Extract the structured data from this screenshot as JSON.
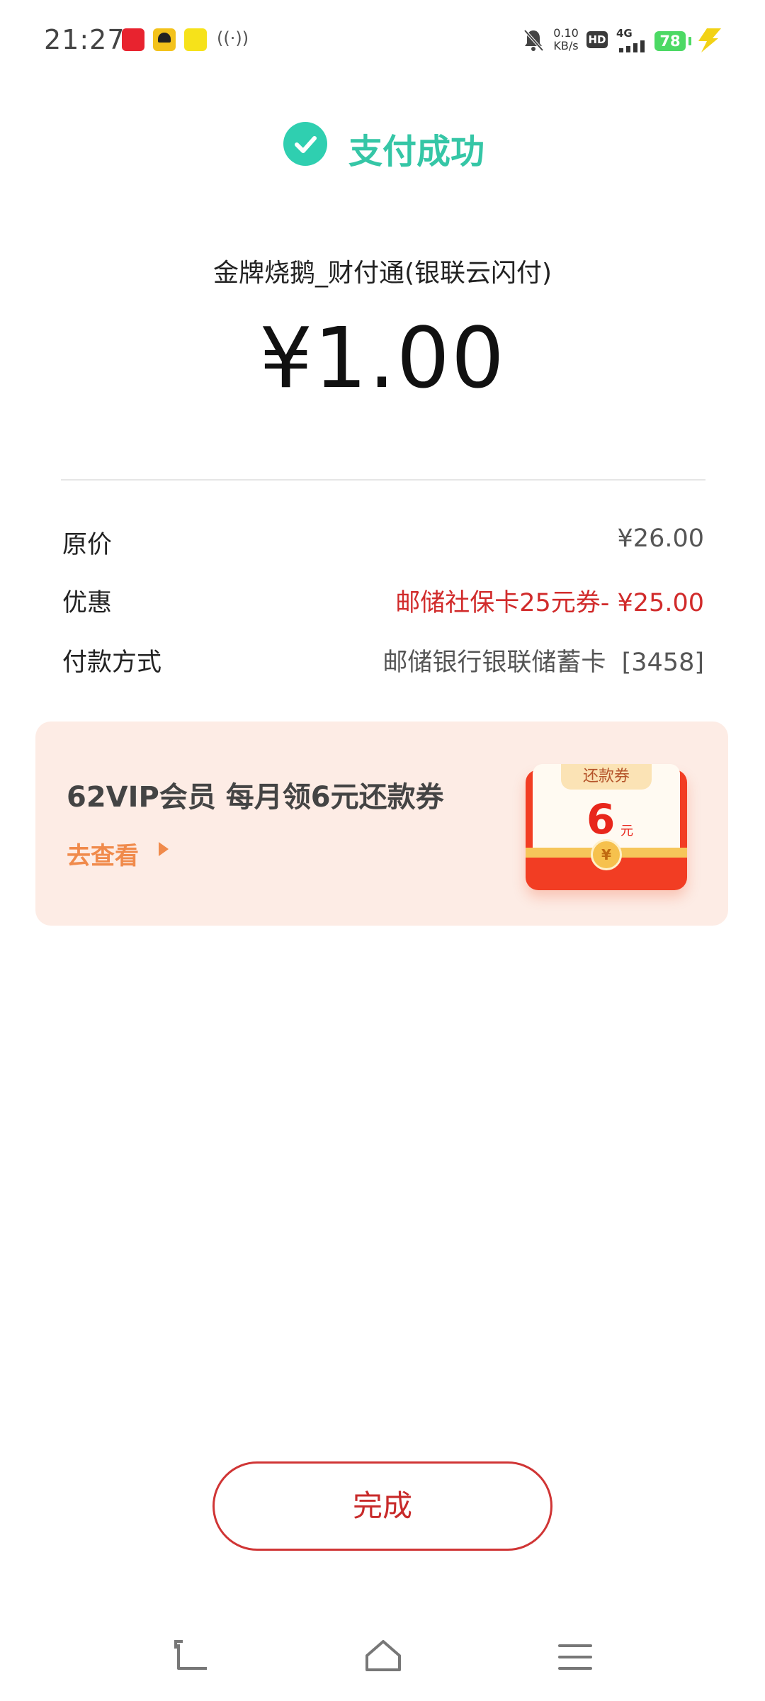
{
  "status_bar": {
    "time": "21:27",
    "net_speed_value": "0.10",
    "net_speed_unit": "KB/s",
    "hd": "HD",
    "network": "4G",
    "battery": "78"
  },
  "header": {
    "title": "支付成功",
    "merchant": "金牌烧鹅_财付通(银联云闪付)",
    "amount": "¥1.00"
  },
  "details": [
    {
      "label": "原价",
      "value": "¥26.00"
    },
    {
      "label": "优惠",
      "value": "邮储社保卡25元券- ¥25.00"
    },
    {
      "label": "付款方式",
      "value": "邮储银行银联储蓄卡  [3458]"
    }
  ],
  "promo": {
    "title": "62VIP会员 每月领6元还款券",
    "link": "去查看",
    "coupon_label": "还款券",
    "coupon_amount": "6",
    "coupon_unit": "元",
    "coupon_coin": "¥"
  },
  "actions": {
    "done": "完成"
  },
  "colors": {
    "success": "#35c6a6",
    "discount": "#d12b2b",
    "promo_bg": "#fdece5",
    "link": "#f08a4b"
  }
}
